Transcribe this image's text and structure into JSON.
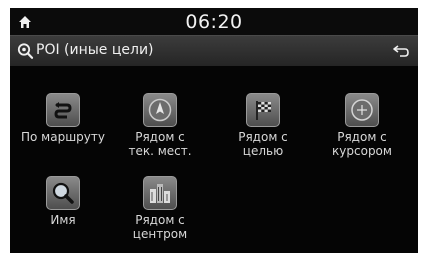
{
  "status": {
    "time": "06:20",
    "home_icon": "home-icon"
  },
  "titlebar": {
    "icon": "poi-search-icon",
    "title": "POI (иные цели)",
    "back_icon": "back-arrow-icon"
  },
  "tiles": [
    {
      "label": "По маршруту",
      "icon": "route-icon"
    },
    {
      "label": "Рядом с\nтек. мест.",
      "icon": "compass-icon"
    },
    {
      "label": "Рядом с\nцелью",
      "icon": "checkered-flag-icon"
    },
    {
      "label": "Рядом с\nкурсором",
      "icon": "cursor-icon"
    },
    {
      "label": "Имя",
      "icon": "magnifier-icon"
    },
    {
      "label": "Рядом с\nцентром",
      "icon": "city-buildings-icon"
    }
  ]
}
